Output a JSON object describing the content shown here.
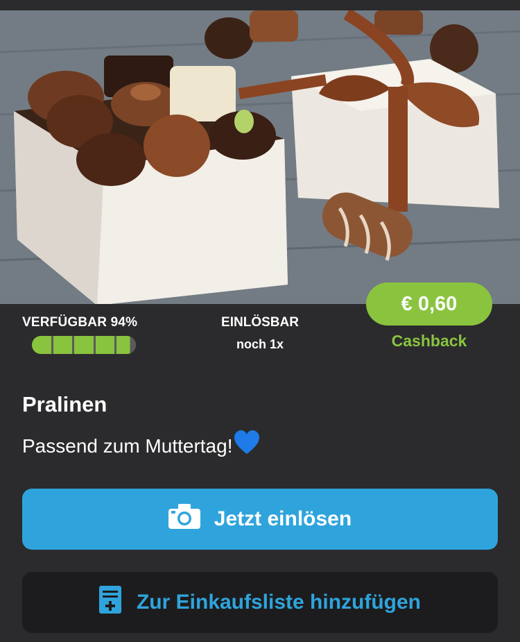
{
  "offer": {
    "availability_label": "VERFÜGBAR 94%",
    "availability_percent": 94,
    "redeemable_title": "EINLÖSBAR",
    "redeemable_sub": "noch 1x",
    "price": "€ 0,60",
    "cashback_label": "Cashback",
    "title": "Pralinen",
    "description": "Passend zum Muttertag!"
  },
  "actions": {
    "redeem_label": "Jetzt einlösen",
    "add_to_list_label": "Zur Einkaufsliste hinzufügen"
  },
  "icons": {
    "redeem": "camera-icon",
    "add_to_list": "shopping-list-add-icon",
    "emoji": "blue-heart-icon"
  },
  "colors": {
    "background": "#2b2b2d",
    "accent_green": "#8ac43f",
    "accent_blue": "#2fa4dc",
    "secondary_button": "#1c1c1e"
  }
}
